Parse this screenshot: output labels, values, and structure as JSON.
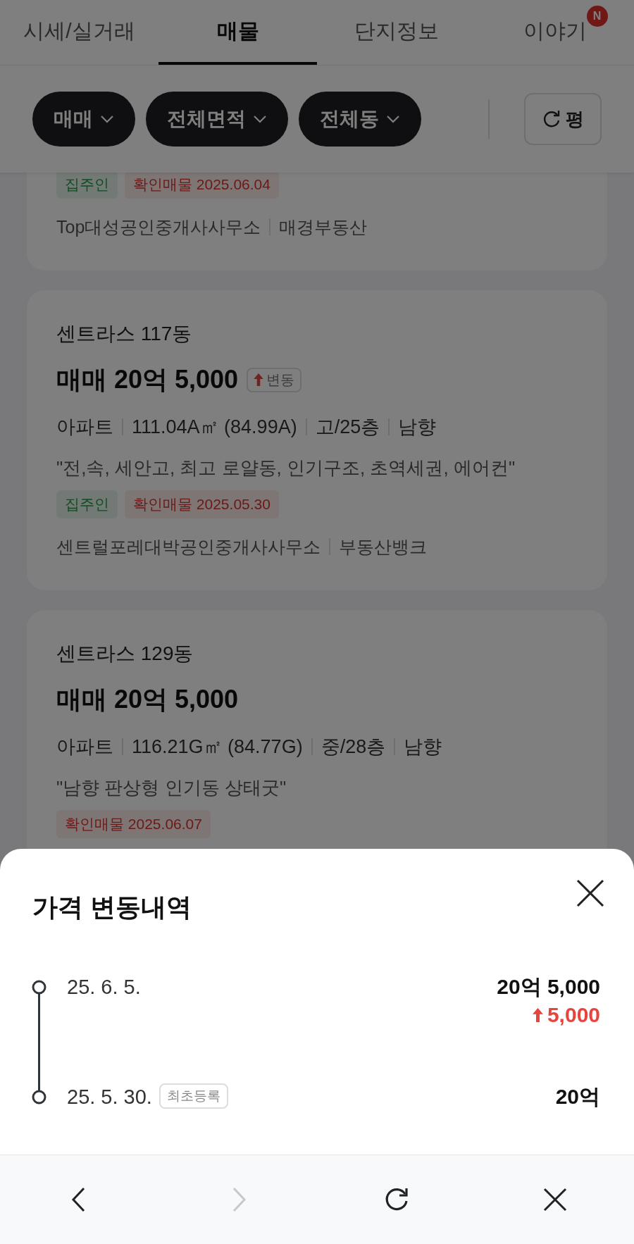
{
  "tabs": [
    {
      "label": "시세/실거래",
      "selected": false
    },
    {
      "label": "매물",
      "selected": true
    },
    {
      "label": "단지정보",
      "selected": false
    },
    {
      "label": "이야기",
      "selected": false,
      "badge": "N"
    }
  ],
  "filters": [
    {
      "label": "매매"
    },
    {
      "label": "전체면적"
    },
    {
      "label": "전체동"
    }
  ],
  "unit_toggle": {
    "label": "평"
  },
  "listings": [
    {
      "tags": [
        {
          "kind": "owner",
          "text": "집주인"
        },
        {
          "kind": "confirmed",
          "text": "확인매물 2025.06.04"
        }
      ],
      "agencies": [
        "Top대성공인중개사사무소",
        "매경부동산"
      ]
    },
    {
      "title": "센트라스 117동",
      "price": "매매 20억 5,000",
      "change_badge": "변동",
      "details": [
        "아파트",
        "111.04A㎡ (84.99A)",
        "고/25층",
        "남향"
      ],
      "description": "\"전,속, 세안고, 최고 로얄동, 인기구조, 초역세권, 에어컨\"",
      "tags": [
        {
          "kind": "owner",
          "text": "집주인"
        },
        {
          "kind": "confirmed",
          "text": "확인매물 2025.05.30"
        }
      ],
      "agencies": [
        "센트럴포레대박공인중개사사무소",
        "부동산뱅크"
      ]
    },
    {
      "title": "센트라스 129동",
      "price": "매매 20억 5,000",
      "details": [
        "아파트",
        "116.21G㎡ (84.77G)",
        "중/28층",
        "남향"
      ],
      "description": "\"남향 판상형 인기동 상태굿\"",
      "tags": [
        {
          "kind": "confirmed",
          "text": "확인매물 2025.06.07"
        }
      ]
    }
  ],
  "sheet": {
    "title": "가격 변동내역",
    "history": [
      {
        "date": "25. 6. 5.",
        "price": "20억 5,000",
        "change": "5,000"
      },
      {
        "date": "25. 5. 30.",
        "note": "최초등록",
        "price": "20억"
      }
    ]
  },
  "bottom_nav": [
    {
      "kind": "back",
      "disabled": false
    },
    {
      "kind": "forward",
      "disabled": true
    },
    {
      "kind": "refresh",
      "disabled": false
    },
    {
      "kind": "close",
      "disabled": false
    }
  ]
}
